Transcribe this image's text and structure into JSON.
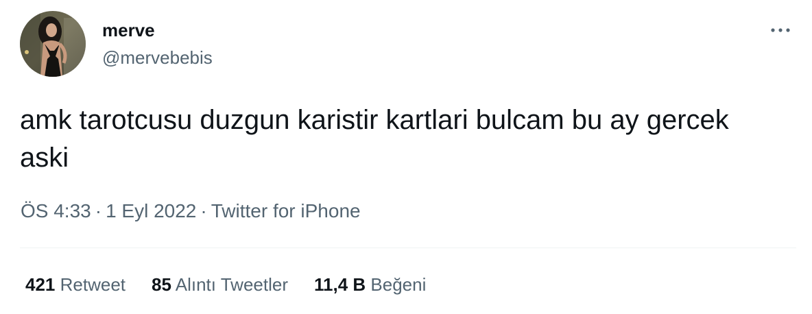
{
  "user": {
    "display_name": "merve",
    "handle": "@mervebebis"
  },
  "menu": {
    "icon": "more-horizontal-icon"
  },
  "tweet": {
    "text": "amk tarotcusu duzgun karistir kartlari bulcam bu ay gercek aski",
    "time": "ÖS 4:33",
    "separator": "·",
    "date": "1 Eyl 2022",
    "source": "Twitter for iPhone"
  },
  "stats": {
    "retweets": {
      "count": "421",
      "label": "Retweet"
    },
    "quotes": {
      "count": "85",
      "label": "Alıntı Tweetler"
    },
    "likes": {
      "count": "11,4 B",
      "label": "Beğeni"
    }
  },
  "colors": {
    "text": "#0f1419",
    "secondary": "#536471",
    "divider": "#eff3f4"
  }
}
